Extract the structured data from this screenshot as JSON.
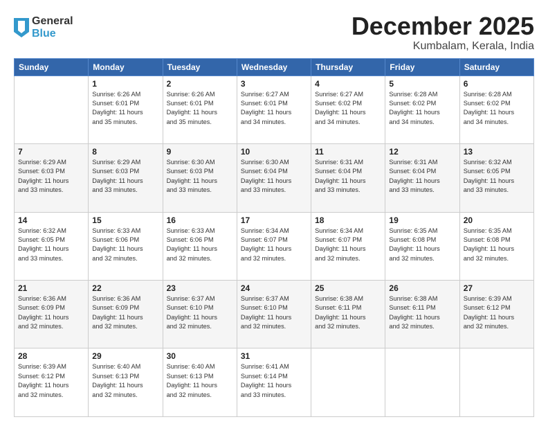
{
  "logo": {
    "general": "General",
    "blue": "Blue"
  },
  "title": "December 2025",
  "location": "Kumbalam, Kerala, India",
  "days_of_week": [
    "Sunday",
    "Monday",
    "Tuesday",
    "Wednesday",
    "Thursday",
    "Friday",
    "Saturday"
  ],
  "weeks": [
    [
      {
        "day": "",
        "info": ""
      },
      {
        "day": "1",
        "info": "Sunrise: 6:26 AM\nSunset: 6:01 PM\nDaylight: 11 hours\nand 35 minutes."
      },
      {
        "day": "2",
        "info": "Sunrise: 6:26 AM\nSunset: 6:01 PM\nDaylight: 11 hours\nand 35 minutes."
      },
      {
        "day": "3",
        "info": "Sunrise: 6:27 AM\nSunset: 6:01 PM\nDaylight: 11 hours\nand 34 minutes."
      },
      {
        "day": "4",
        "info": "Sunrise: 6:27 AM\nSunset: 6:02 PM\nDaylight: 11 hours\nand 34 minutes."
      },
      {
        "day": "5",
        "info": "Sunrise: 6:28 AM\nSunset: 6:02 PM\nDaylight: 11 hours\nand 34 minutes."
      },
      {
        "day": "6",
        "info": "Sunrise: 6:28 AM\nSunset: 6:02 PM\nDaylight: 11 hours\nand 34 minutes."
      }
    ],
    [
      {
        "day": "7",
        "info": "Sunrise: 6:29 AM\nSunset: 6:03 PM\nDaylight: 11 hours\nand 33 minutes."
      },
      {
        "day": "8",
        "info": "Sunrise: 6:29 AM\nSunset: 6:03 PM\nDaylight: 11 hours\nand 33 minutes."
      },
      {
        "day": "9",
        "info": "Sunrise: 6:30 AM\nSunset: 6:03 PM\nDaylight: 11 hours\nand 33 minutes."
      },
      {
        "day": "10",
        "info": "Sunrise: 6:30 AM\nSunset: 6:04 PM\nDaylight: 11 hours\nand 33 minutes."
      },
      {
        "day": "11",
        "info": "Sunrise: 6:31 AM\nSunset: 6:04 PM\nDaylight: 11 hours\nand 33 minutes."
      },
      {
        "day": "12",
        "info": "Sunrise: 6:31 AM\nSunset: 6:04 PM\nDaylight: 11 hours\nand 33 minutes."
      },
      {
        "day": "13",
        "info": "Sunrise: 6:32 AM\nSunset: 6:05 PM\nDaylight: 11 hours\nand 33 minutes."
      }
    ],
    [
      {
        "day": "14",
        "info": "Sunrise: 6:32 AM\nSunset: 6:05 PM\nDaylight: 11 hours\nand 33 minutes."
      },
      {
        "day": "15",
        "info": "Sunrise: 6:33 AM\nSunset: 6:06 PM\nDaylight: 11 hours\nand 32 minutes."
      },
      {
        "day": "16",
        "info": "Sunrise: 6:33 AM\nSunset: 6:06 PM\nDaylight: 11 hours\nand 32 minutes."
      },
      {
        "day": "17",
        "info": "Sunrise: 6:34 AM\nSunset: 6:07 PM\nDaylight: 11 hours\nand 32 minutes."
      },
      {
        "day": "18",
        "info": "Sunrise: 6:34 AM\nSunset: 6:07 PM\nDaylight: 11 hours\nand 32 minutes."
      },
      {
        "day": "19",
        "info": "Sunrise: 6:35 AM\nSunset: 6:08 PM\nDaylight: 11 hours\nand 32 minutes."
      },
      {
        "day": "20",
        "info": "Sunrise: 6:35 AM\nSunset: 6:08 PM\nDaylight: 11 hours\nand 32 minutes."
      }
    ],
    [
      {
        "day": "21",
        "info": "Sunrise: 6:36 AM\nSunset: 6:09 PM\nDaylight: 11 hours\nand 32 minutes."
      },
      {
        "day": "22",
        "info": "Sunrise: 6:36 AM\nSunset: 6:09 PM\nDaylight: 11 hours\nand 32 minutes."
      },
      {
        "day": "23",
        "info": "Sunrise: 6:37 AM\nSunset: 6:10 PM\nDaylight: 11 hours\nand 32 minutes."
      },
      {
        "day": "24",
        "info": "Sunrise: 6:37 AM\nSunset: 6:10 PM\nDaylight: 11 hours\nand 32 minutes."
      },
      {
        "day": "25",
        "info": "Sunrise: 6:38 AM\nSunset: 6:11 PM\nDaylight: 11 hours\nand 32 minutes."
      },
      {
        "day": "26",
        "info": "Sunrise: 6:38 AM\nSunset: 6:11 PM\nDaylight: 11 hours\nand 32 minutes."
      },
      {
        "day": "27",
        "info": "Sunrise: 6:39 AM\nSunset: 6:12 PM\nDaylight: 11 hours\nand 32 minutes."
      }
    ],
    [
      {
        "day": "28",
        "info": "Sunrise: 6:39 AM\nSunset: 6:12 PM\nDaylight: 11 hours\nand 32 minutes."
      },
      {
        "day": "29",
        "info": "Sunrise: 6:40 AM\nSunset: 6:13 PM\nDaylight: 11 hours\nand 32 minutes."
      },
      {
        "day": "30",
        "info": "Sunrise: 6:40 AM\nSunset: 6:13 PM\nDaylight: 11 hours\nand 32 minutes."
      },
      {
        "day": "31",
        "info": "Sunrise: 6:41 AM\nSunset: 6:14 PM\nDaylight: 11 hours\nand 33 minutes."
      },
      {
        "day": "",
        "info": ""
      },
      {
        "day": "",
        "info": ""
      },
      {
        "day": "",
        "info": ""
      }
    ]
  ]
}
